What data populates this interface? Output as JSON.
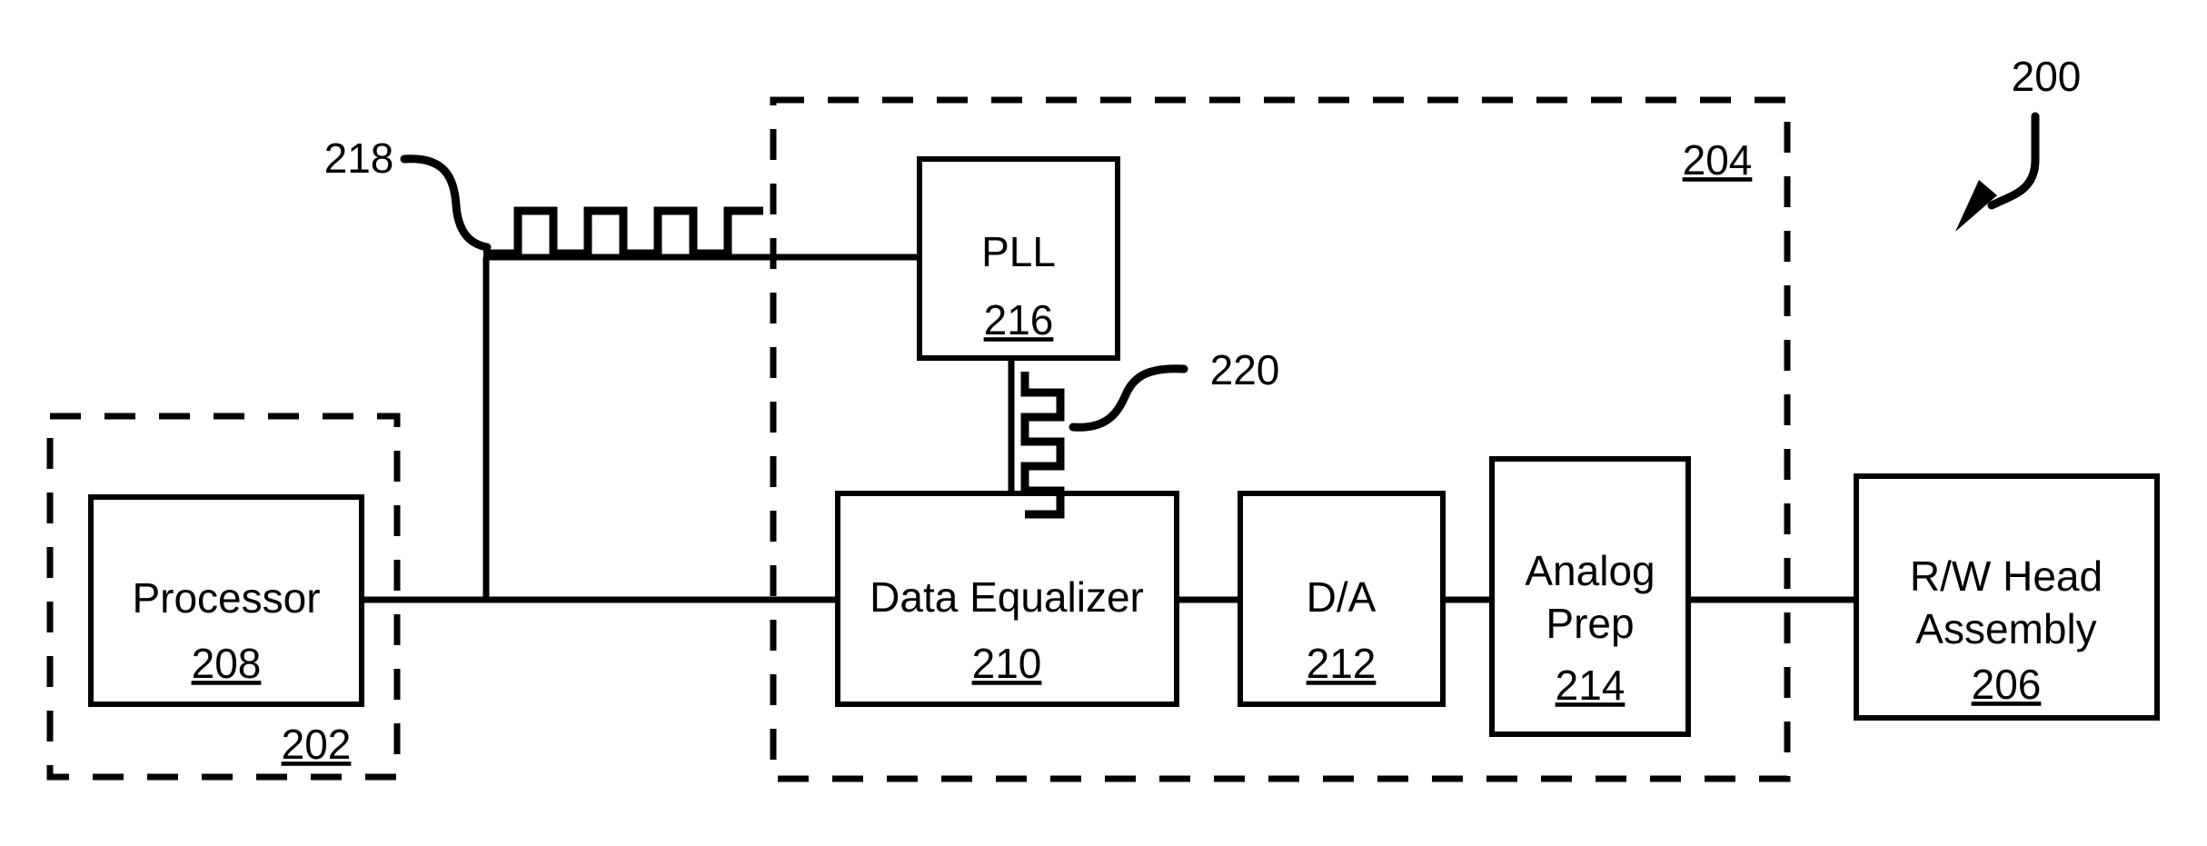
{
  "figure": {
    "figure_number": "200",
    "type": "patent-block-diagram"
  },
  "enclosures": [
    {
      "id": "host-enclosure",
      "ref": "202",
      "style": "dashed"
    },
    {
      "id": "controller-enclosure",
      "ref": "204",
      "style": "dashed"
    }
  ],
  "blocks": [
    {
      "id": "processor",
      "line1": "Processor",
      "line2": "",
      "ref": "208"
    },
    {
      "id": "data-equalizer",
      "line1": "Data Equalizer",
      "line2": "",
      "ref": "210"
    },
    {
      "id": "da-converter",
      "line1": "D/A",
      "line2": "",
      "ref": "212"
    },
    {
      "id": "analog-prep",
      "line1": "Analog",
      "line2": "Prep",
      "ref": "214"
    },
    {
      "id": "pll",
      "line1": "PLL",
      "line2": "",
      "ref": "216"
    },
    {
      "id": "rw-head-assembly",
      "line1": "R/W Head",
      "line2": "Assembly",
      "ref": "206"
    }
  ],
  "signals": [
    {
      "id": "clock-signal-218",
      "ref": "218",
      "shape": "square-wave-horizontal",
      "pulses": 4
    },
    {
      "id": "clock-signal-220",
      "ref": "220",
      "shape": "square-wave-vertical",
      "pulses": 4
    }
  ],
  "labels": {
    "fig_200": "200",
    "ref_202": "202",
    "ref_204": "204",
    "ref_206": "206",
    "ref_208": "208",
    "ref_210": "210",
    "ref_212": "212",
    "ref_214": "214",
    "ref_216": "216",
    "ref_218": "218",
    "ref_220": "220",
    "processor": "Processor",
    "data_equalizer": "Data Equalizer",
    "da": "D/A",
    "analog": "Analog",
    "prep": "Prep",
    "pll": "PLL",
    "rw_head": "R/W Head",
    "assembly": "Assembly"
  },
  "colors": {
    "line": "#000000",
    "background": "#ffffff",
    "text": "#000000"
  }
}
